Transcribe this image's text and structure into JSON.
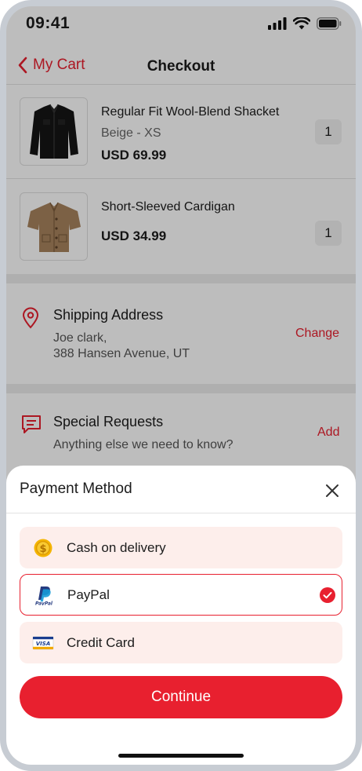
{
  "status_bar": {
    "time": "09:41"
  },
  "nav": {
    "back_label": "My Cart",
    "title": "Checkout"
  },
  "cart_items": [
    {
      "name": "Regular Fit Wool-Blend Shacket",
      "variant": "Beige - XS",
      "price": "USD 69.99",
      "qty": "1"
    },
    {
      "name": "Short-Sleeved Cardigan",
      "variant": "",
      "price": "USD 34.99",
      "qty": "1"
    }
  ],
  "shipping": {
    "title": "Shipping Address",
    "line1": "Joe clark,",
    "line2": "388 Hansen Avenue, UT",
    "action": "Change"
  },
  "requests": {
    "title": "Special Requests",
    "placeholder": "Anything else we need to know?",
    "action": "Add"
  },
  "payment_sheet": {
    "title": "Payment Method",
    "options": [
      {
        "label": "Cash on delivery",
        "icon": "coin-icon",
        "selected": false
      },
      {
        "label": "PayPal",
        "icon": "paypal-icon",
        "selected": true
      },
      {
        "label": "Credit Card",
        "icon": "visa-card-icon",
        "selected": false
      }
    ],
    "continue_label": "Continue"
  },
  "colors": {
    "accent": "#e8202f",
    "option_bg": "#fdeeeb",
    "overlay": "rgba(0,0,0,0.26)"
  }
}
